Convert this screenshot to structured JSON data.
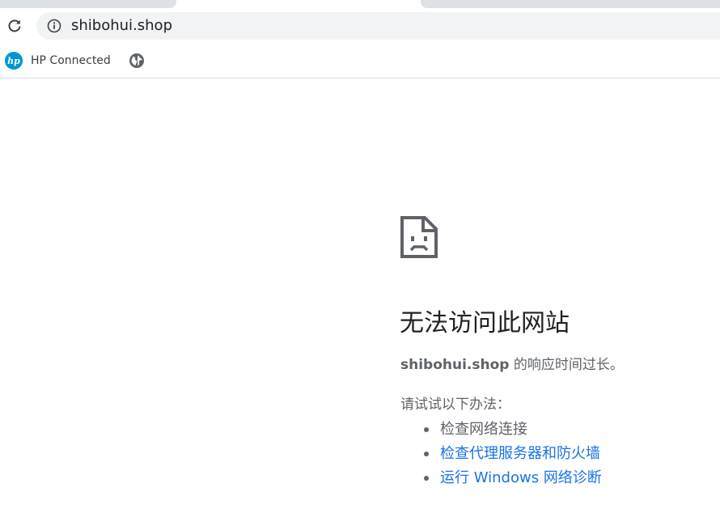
{
  "address_bar": {
    "url": "shibohui.shop"
  },
  "bookmarks": {
    "items": [
      {
        "label": "HP Connected",
        "icon": "hp-logo-icon"
      },
      {
        "label": "",
        "icon": "globe-icon"
      }
    ]
  },
  "hp_logo_text": "hp",
  "error": {
    "title": "无法访问此网站",
    "host": "shibohui.shop",
    "message": " 的响应时间过长。",
    "suggestions_heading": "请试试以下办法：",
    "suggestions": [
      {
        "label": "检查网络连接",
        "is_link": false
      },
      {
        "label": "检查代理服务器和防火墙",
        "is_link": true
      },
      {
        "label": "运行 Windows 网络诊断",
        "is_link": true
      }
    ]
  },
  "colors": {
    "link": "#1a73e8",
    "text_secondary": "#5f6368",
    "omnibox_bg": "#f1f3f4",
    "hp_blue": "#0096d6"
  }
}
